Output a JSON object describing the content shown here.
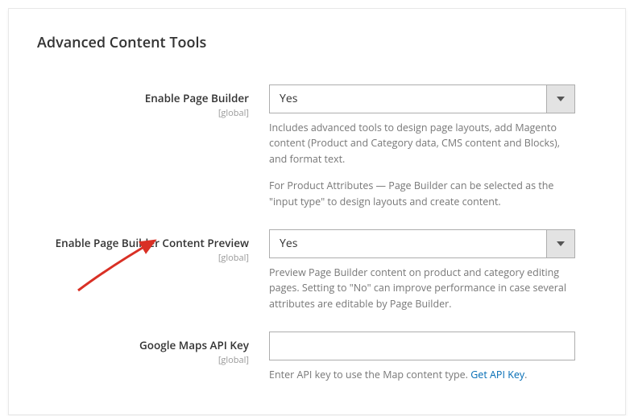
{
  "section": {
    "title": "Advanced Content Tools"
  },
  "fields": {
    "enable_page_builder": {
      "label": "Enable Page Builder",
      "scope": "[global]",
      "value": "Yes",
      "note1": "Includes advanced tools to design page layouts, add Magento content (Product and Category data, CMS content and Blocks), and format text.",
      "note2": "For Product Attributes — Page Builder can be selected as the \"input type\" to design layouts and create content."
    },
    "enable_preview": {
      "label": "Enable Page Builder Content Preview",
      "scope": "[global]",
      "value": "Yes",
      "note": "Preview Page Builder content on product and category editing pages. Setting to \"No\" can improve performance in case several attributes are editable by Page Builder."
    },
    "google_maps": {
      "label": "Google Maps API Key",
      "scope": "[global]",
      "value": "",
      "note_prefix": "Enter API key to use the Map content type. ",
      "link_text": "Get API Key",
      "note_suffix": "."
    }
  }
}
